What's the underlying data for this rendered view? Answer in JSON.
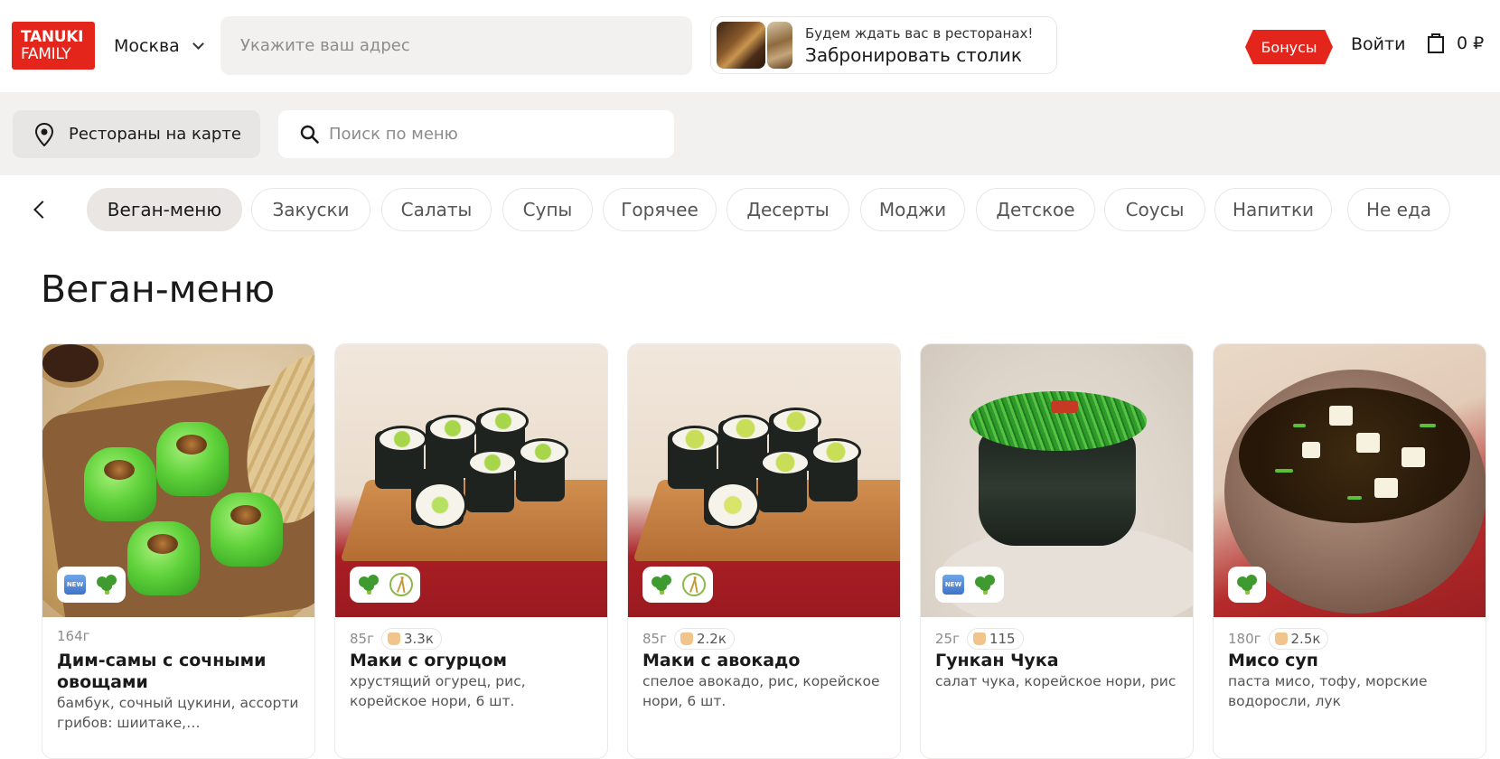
{
  "header": {
    "logo": {
      "line1": "TANUKI",
      "line2": "FAMILY"
    },
    "city": "Москва",
    "address_placeholder": "Укажите ваш адрес",
    "reserve": {
      "subtitle": "Будем ждать вас в ресторанах!",
      "title": "Забронировать столик"
    },
    "bonus_label": "Бонусы",
    "login_label": "Войти",
    "cart_total": "0 ₽"
  },
  "subbar": {
    "map_label": "Рестораны на карте",
    "search_placeholder": "Поиск по меню"
  },
  "categories": [
    {
      "label": "Веган-меню",
      "active": true
    },
    {
      "label": "Закуски"
    },
    {
      "label": "Салаты"
    },
    {
      "label": "Супы"
    },
    {
      "label": "Горячее"
    },
    {
      "label": "Десерты"
    },
    {
      "label": "Моджи"
    },
    {
      "label": "Детское"
    },
    {
      "label": "Соусы"
    },
    {
      "label": "Напитки"
    },
    {
      "label": "Не еда"
    }
  ],
  "page_title": "Веган-меню",
  "products": [
    {
      "weight": "164г",
      "rating": "",
      "name": "Дим-самы с сочными овощами",
      "description": "бамбук, сочный цукини, ассорти грибов: шиитаке,…",
      "badges": [
        "new-icon",
        "broccoli-icon"
      ]
    },
    {
      "weight": "85г",
      "rating": "3.3к",
      "name": "Маки с огурцом",
      "description": "хрустящий огурец, рис, корейское нори, 6 шт.",
      "badges": [
        "broccoli-icon",
        "chopsticks-icon"
      ]
    },
    {
      "weight": "85г",
      "rating": "2.2к",
      "name": "Маки с авокадо",
      "description": "спелое авокадо, рис, корейское нори, 6 шт.",
      "badges": [
        "broccoli-icon",
        "chopsticks-icon"
      ]
    },
    {
      "weight": "25г",
      "rating": "115",
      "name": "Гункан Чука",
      "description": "салат чука, корейское нори, рис",
      "badges": [
        "new-icon",
        "broccoli-icon"
      ]
    },
    {
      "weight": "180г",
      "rating": "2.5к",
      "name": "Мисо суп",
      "description": "паста мисо, тофу, морские водоросли, лук",
      "badges": [
        "broccoli-icon"
      ]
    }
  ],
  "colors": {
    "brand_red": "#e3251c",
    "chip_active": "#e9e6e4",
    "subbar_bg": "#f2f1f0"
  }
}
